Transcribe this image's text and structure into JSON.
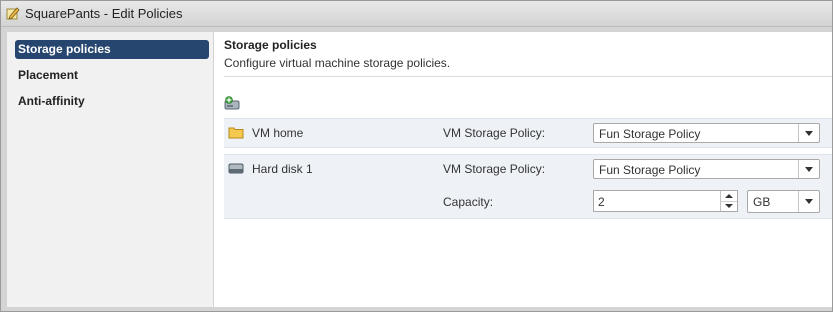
{
  "window": {
    "title": "SquarePants - Edit Policies",
    "icon": "pencil-edit-icon"
  },
  "sidebar": {
    "items": [
      {
        "label": "Storage policies",
        "selected": true
      },
      {
        "label": "Placement",
        "selected": false
      },
      {
        "label": "Anti-affinity",
        "selected": false
      }
    ]
  },
  "header": {
    "title": "Storage policies",
    "subtitle": "Configure virtual machine storage policies."
  },
  "toolbar": {
    "add_icon": "add-disk-icon"
  },
  "rows": [
    {
      "name": "VM home",
      "icon": "folder-icon",
      "policy_label": "VM Storage Policy:",
      "policy_value": "Fun Storage Policy"
    },
    {
      "name": "Hard disk 1",
      "icon": "hard-disk-icon",
      "policy_label": "VM Storage Policy:",
      "policy_value": "Fun Storage Policy",
      "capacity_label": "Capacity:",
      "capacity_value": "2",
      "unit_value": "GB"
    }
  ],
  "colors": {
    "selected_nav": "#27466f",
    "row_bg": "#eef2f6",
    "folder": "#f5c850"
  }
}
